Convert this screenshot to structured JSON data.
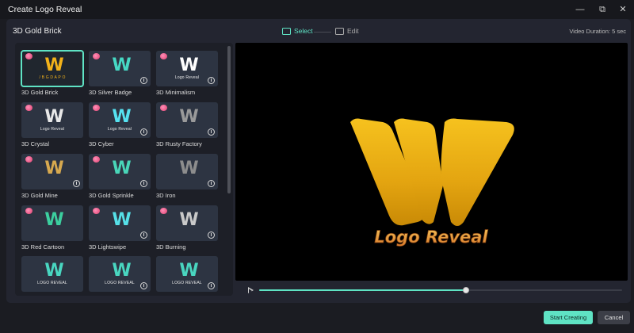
{
  "window": {
    "title": "Create Logo Reveal",
    "minimize_glyph": "—",
    "restore_glyph": "⧉",
    "close_glyph": "✕"
  },
  "header": {
    "template_title": "3D Gold Brick",
    "steps": [
      {
        "label": "Select",
        "active": true,
        "icon": "select-step-icon"
      },
      {
        "label": "Edit",
        "active": false,
        "icon": "edit-step-icon"
      }
    ],
    "video_duration": "Video Duration: 5 sec"
  },
  "templates": [
    {
      "name": "3D Gold Brick",
      "premium": true,
      "selected": true,
      "downloadable": false,
      "logo_color": "#f2b21a",
      "sub_text": "/ B G D A P O"
    },
    {
      "name": "3D Silver Badge",
      "premium": true,
      "selected": false,
      "downloadable": true,
      "logo_color": "#46d9c4",
      "sub_text": ""
    },
    {
      "name": "3D Minimalism",
      "premium": true,
      "selected": false,
      "downloadable": true,
      "logo_color": "#ffffff",
      "sub_text": "Logo Reveal"
    },
    {
      "name": "3D Crystal",
      "premium": true,
      "selected": false,
      "downloadable": false,
      "logo_color": "#e8e8e8",
      "sub_text": "Logo Reveal"
    },
    {
      "name": "3D Cyber",
      "premium": true,
      "selected": false,
      "downloadable": true,
      "logo_color": "#56e2f0",
      "sub_text": "Logo Reveal"
    },
    {
      "name": "3D Rusty Factory",
      "premium": true,
      "selected": false,
      "downloadable": true,
      "logo_color": "#9a9a9a",
      "sub_text": ""
    },
    {
      "name": "3D Gold Mine",
      "premium": true,
      "selected": false,
      "downloadable": true,
      "logo_color": "#d7a94f",
      "sub_text": ""
    },
    {
      "name": "3D Gold Sprinkle",
      "premium": true,
      "selected": false,
      "downloadable": true,
      "logo_color": "#49d6b8",
      "sub_text": ""
    },
    {
      "name": "3D Iron",
      "premium": false,
      "selected": false,
      "downloadable": true,
      "logo_color": "#8d8d8d",
      "sub_text": ""
    },
    {
      "name": "3D Red Cartoon",
      "premium": true,
      "selected": false,
      "downloadable": false,
      "logo_color": "#3ccf9f",
      "sub_text": ""
    },
    {
      "name": "3D Lightswipe",
      "premium": true,
      "selected": false,
      "downloadable": true,
      "logo_color": "#56e0e8",
      "sub_text": ""
    },
    {
      "name": "3D Burning",
      "premium": true,
      "selected": false,
      "downloadable": true,
      "logo_color": "#c9c9c9",
      "sub_text": ""
    },
    {
      "name": "",
      "premium": false,
      "selected": false,
      "downloadable": false,
      "logo_color": "#49d6c0",
      "sub_text": "LOGO REVEAL"
    },
    {
      "name": "",
      "premium": false,
      "selected": false,
      "downloadable": true,
      "logo_color": "#49d6c0",
      "sub_text": "LOGO REVEAL"
    },
    {
      "name": "",
      "premium": false,
      "selected": false,
      "downloadable": true,
      "logo_color": "#49d6c0",
      "sub_text": "LOGO REVEAL"
    }
  ],
  "preview": {
    "logo_text": "Logo Reveal",
    "logo_color": "#f2b21a",
    "playback_progress": 0.57
  },
  "buttons": {
    "start": "Start Creating",
    "cancel": "Cancel"
  },
  "colors": {
    "accent": "#5fe3c4",
    "premium_gem": "#ff6fa0"
  }
}
